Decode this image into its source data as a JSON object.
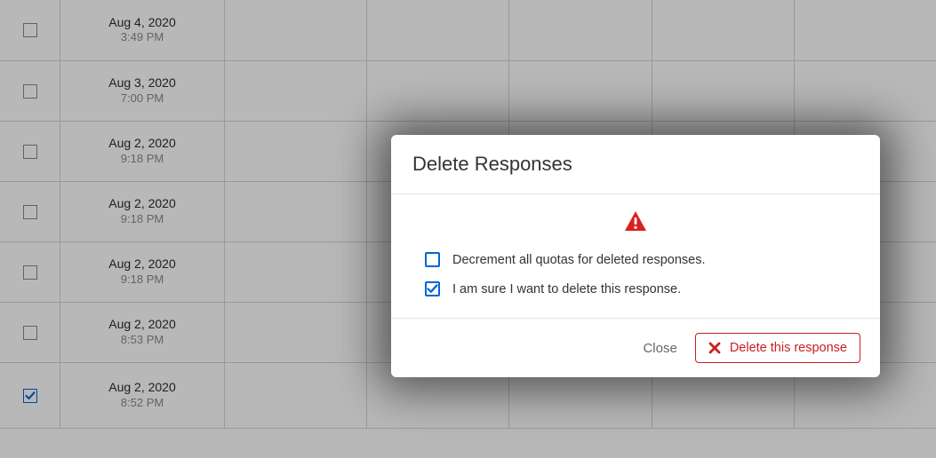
{
  "table": {
    "rows": [
      {
        "date": "Aug 4, 2020",
        "time": "3:49 PM",
        "checked": false
      },
      {
        "date": "Aug 3, 2020",
        "time": "7:00 PM",
        "checked": false
      },
      {
        "date": "Aug 2, 2020",
        "time": "9:18 PM",
        "checked": false
      },
      {
        "date": "Aug 2, 2020",
        "time": "9:18 PM",
        "checked": false
      },
      {
        "date": "Aug 2, 2020",
        "time": "9:18 PM",
        "checked": false
      },
      {
        "date": "Aug 2, 2020",
        "time": "8:53 PM",
        "checked": false
      },
      {
        "date": "Aug 2, 2020",
        "time": "8:52 PM",
        "checked": true
      }
    ]
  },
  "modal": {
    "title": "Delete Responses",
    "options": {
      "decrement": {
        "label": "Decrement all quotas for deleted responses.",
        "checked": false
      },
      "confirm": {
        "label": "I am sure I want to delete this response.",
        "checked": true
      }
    },
    "close_label": "Close",
    "delete_label": "Delete this response"
  },
  "icons": {
    "warning": "warning-triangle",
    "delete_x": "close-x"
  },
  "colors": {
    "accent": "#0066d6",
    "danger": "#c91f1f"
  }
}
